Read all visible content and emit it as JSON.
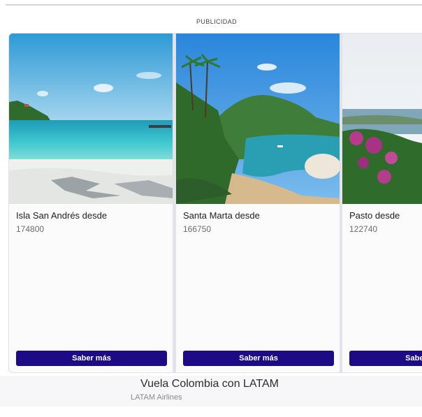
{
  "ad_label": "PUBLICIDAD",
  "cards": [
    {
      "title": "Isla San Andrés desde",
      "price": "174800",
      "button_label": "Saber más",
      "image": "tropical beach with turquoise water and palm shadow"
    },
    {
      "title": "Santa Marta desde",
      "price": "166750",
      "button_label": "Saber más",
      "image": "bay with palm trees, green hills and rocky beach"
    },
    {
      "title": "Pasto desde",
      "price": "122740",
      "button_label": "Saber más",
      "image": "pink flowering shrubs overlooking a lake and mountains"
    }
  ],
  "footer": {
    "title": "Vuela Colombia con LATAM",
    "advertiser": "LATAM Airlines"
  },
  "colors": {
    "button": "#1c0b85",
    "footer_bg": "#f7f7f9",
    "carousel_bg": "#e3e3e8"
  }
}
